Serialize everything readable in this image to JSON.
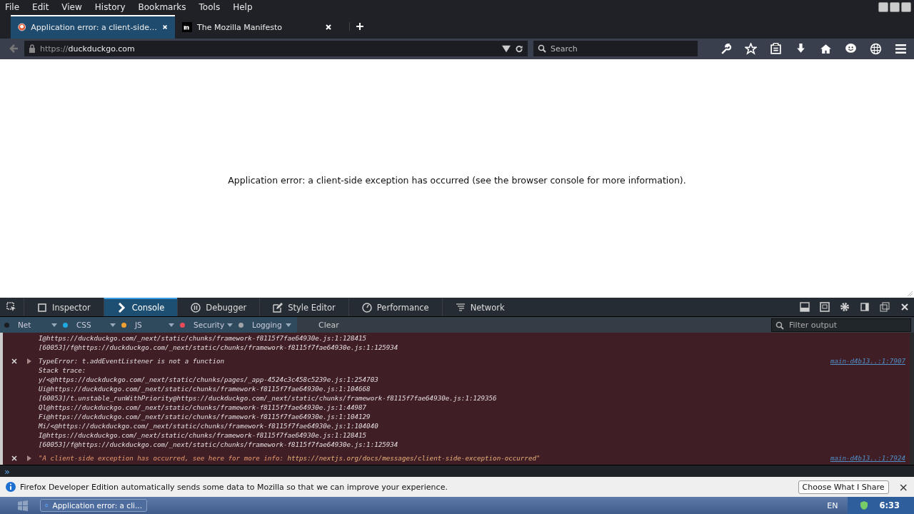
{
  "menu": [
    "File",
    "Edit",
    "View",
    "History",
    "Bookmarks",
    "Tools",
    "Help"
  ],
  "tabs": [
    {
      "title": "Application error: a client-side…",
      "selected": true,
      "kind": "duck"
    },
    {
      "title": "The Mozilla Manifesto",
      "selected": false,
      "kind": "mozilla"
    }
  ],
  "address": {
    "url_prefix": "https://",
    "url_host": "duckduckgo.com"
  },
  "search": {
    "placeholder": "Search"
  },
  "page": {
    "message": "Application error: a client-side exception has occurred (see the browser console for more information)."
  },
  "devtools": {
    "tabs": [
      {
        "label": "Inspector",
        "selected": false,
        "kind": "inspector"
      },
      {
        "label": "Console",
        "selected": true,
        "kind": "console"
      },
      {
        "label": "Debugger",
        "selected": false,
        "kind": "debugger"
      },
      {
        "label": "Style Editor",
        "selected": false,
        "kind": "style"
      },
      {
        "label": "Performance",
        "selected": false,
        "kind": "performance"
      },
      {
        "label": "Network",
        "selected": false,
        "kind": "network"
      }
    ],
    "filters": [
      {
        "label": "Net",
        "color": "#1a1d22"
      },
      {
        "label": "CSS",
        "color": "#1fa9e0"
      },
      {
        "label": "JS",
        "color": "#f0a030"
      },
      {
        "label": "Security",
        "color": "#e94a5a"
      },
      {
        "label": "Logging",
        "color": "#a0a4a8"
      }
    ],
    "clear": "Clear",
    "filter_placeholder": "Filter output",
    "messages": [
      {
        "kind": "trace",
        "lines": [
          "I@https://duckduckgo.com/_next/static/chunks/framework-f8115f7fae64930e.js:1:128415",
          "[60053]/f@https://duckduckgo.com/_next/static/chunks/framework-f8115f7fae64930e.js:1:125934"
        ]
      },
      {
        "kind": "error",
        "text": "TypeError: t.addEventListener is not a function",
        "location": "main-d4b13..:1:7907",
        "heading": "Stack trace:",
        "lines": [
          "y/<@https://duckduckgo.com/_next/static/chunks/pages/_app-4524c3c458c5239e.js:1:254703",
          "Ui@https://duckduckgo.com/_next/static/chunks/framework-f8115f7fae64930e.js:1:104668",
          "[60053]/t.unstable_runWithPriority@https://duckduckgo.com/_next/static/chunks/framework-f8115f7fae64930e.js:1:129356",
          "Ql@https://duckduckgo.com/_next/static/chunks/framework-f8115f7fae64930e.js:1:44987",
          "Fi@https://duckduckgo.com/_next/static/chunks/framework-f8115f7fae64930e.js:1:104129",
          "Mi/<@https://duckduckgo.com/_next/static/chunks/framework-f8115f7fae64930e.js:1:104040",
          "I@https://duckduckgo.com/_next/static/chunks/framework-f8115f7fae64930e.js:1:128415",
          "[60053]/f@https://duckduckgo.com/_next/static/chunks/framework-f8115f7fae64930e.js:1:125934"
        ]
      },
      {
        "kind": "string",
        "prefix": "\"A client-side exception has occurred, see here for more info: ",
        "link": "https://nextjs.org/docs/messages/client-side-exception-occurred",
        "suffix": "\"",
        "location": "main-d4b13..:1:7924"
      }
    ],
    "prompt": "»"
  },
  "notification": {
    "text": "Firefox Developer Edition automatically sends some data to Mozilla so that we can improve your experience.",
    "button": "Choose What I Share",
    "close": "×"
  },
  "taskbar": {
    "task": "Application error: a cli...",
    "language": "EN",
    "time": "6:33"
  }
}
